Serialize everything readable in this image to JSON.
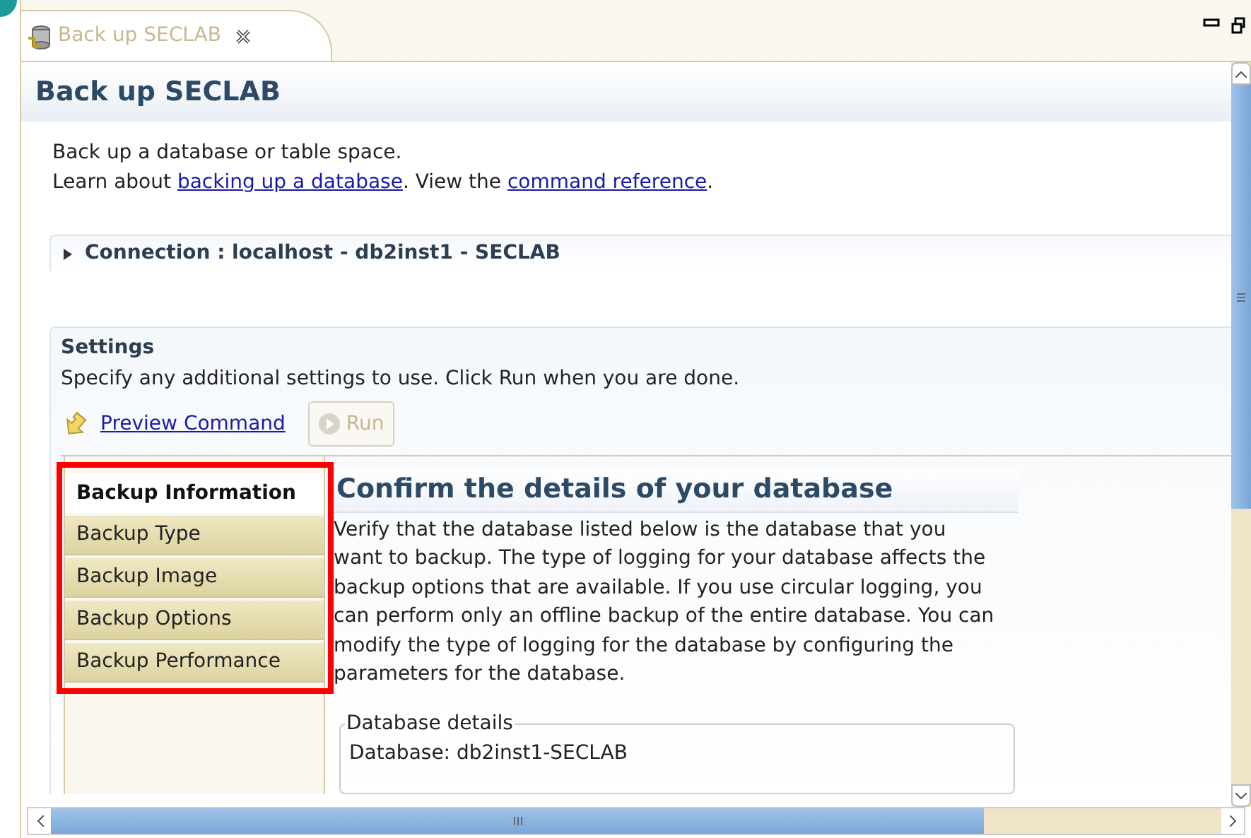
{
  "editor_tab": {
    "label": "Back up SECLAB",
    "selected": true
  },
  "header": {
    "title": "Back up SECLAB"
  },
  "intro": {
    "line_1": "Back up a database or table space.",
    "line_2_parts": [
      {
        "kind": "text",
        "text": "Learn about "
      },
      {
        "kind": "link",
        "text": "backing up a database"
      },
      {
        "kind": "text",
        "text": ". View the "
      },
      {
        "kind": "link",
        "text": "command reference"
      },
      {
        "kind": "text",
        "text": "."
      }
    ]
  },
  "connection": {
    "label": "Connection : localhost - db2inst1 - SECLAB",
    "expanded": false
  },
  "settings": {
    "title": "Settings",
    "description": "Specify any additional settings to use. Click Run when you are done.",
    "preview_link": "Preview Command",
    "run_button": {
      "label": "Run",
      "disabled": true
    }
  },
  "nav": [
    {
      "label": "Backup Information",
      "selected": true
    },
    {
      "label": "Backup Type",
      "selected": false
    },
    {
      "label": "Backup Image",
      "selected": false
    },
    {
      "label": "Backup Options",
      "selected": false
    },
    {
      "label": "Backup Performance",
      "selected": false
    }
  ],
  "page": {
    "title": "Confirm the details of your database",
    "body": "Verify that the database listed below is the database that you want to backup. The type of logging for your database affects the backup options that are available. If you use circular logging, you can perform only an offline backup of the entire database. You can modify the type of logging for the database by configuring the parameters for the database.",
    "group_title": "Database details",
    "database_line": "Database: db2inst1-SECLAB"
  },
  "highlight": {
    "shown": true
  }
}
